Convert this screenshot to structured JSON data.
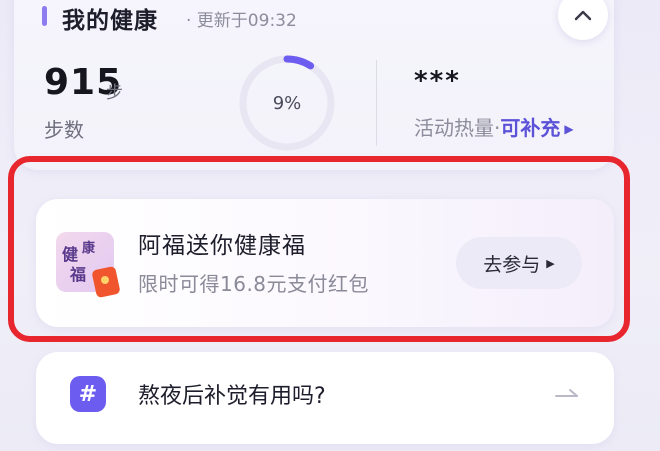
{
  "health": {
    "title": "我的健康",
    "updated": "· 更新于09:32",
    "steps": {
      "value": "915",
      "unit": "步",
      "label": "步数"
    },
    "progress": {
      "text": "9%",
      "fraction": 0.09
    },
    "calories": {
      "value": "***",
      "label": "活动热量·",
      "link": "可补充"
    }
  },
  "promo": {
    "icon_text": "健康福",
    "title": "阿福送你健康福",
    "subtitle": "限时可得16.8元支付红包",
    "button": "去参与"
  },
  "topic": {
    "text": "熬夜后补觉有用吗?"
  },
  "colors": {
    "accent": "#6c5cf0",
    "highlight_border": "#e8262e",
    "ring_track": "#e7e6f2",
    "ring_fill": "#6c5cf0"
  },
  "icons": {
    "collapse": "chevron-up-icon",
    "calories_link": "triangle-right-icon",
    "join": "triangle-right-icon",
    "topic": "hash-icon",
    "topic_arrow": "arrow-right-icon",
    "promo": "red-envelope-icon"
  }
}
